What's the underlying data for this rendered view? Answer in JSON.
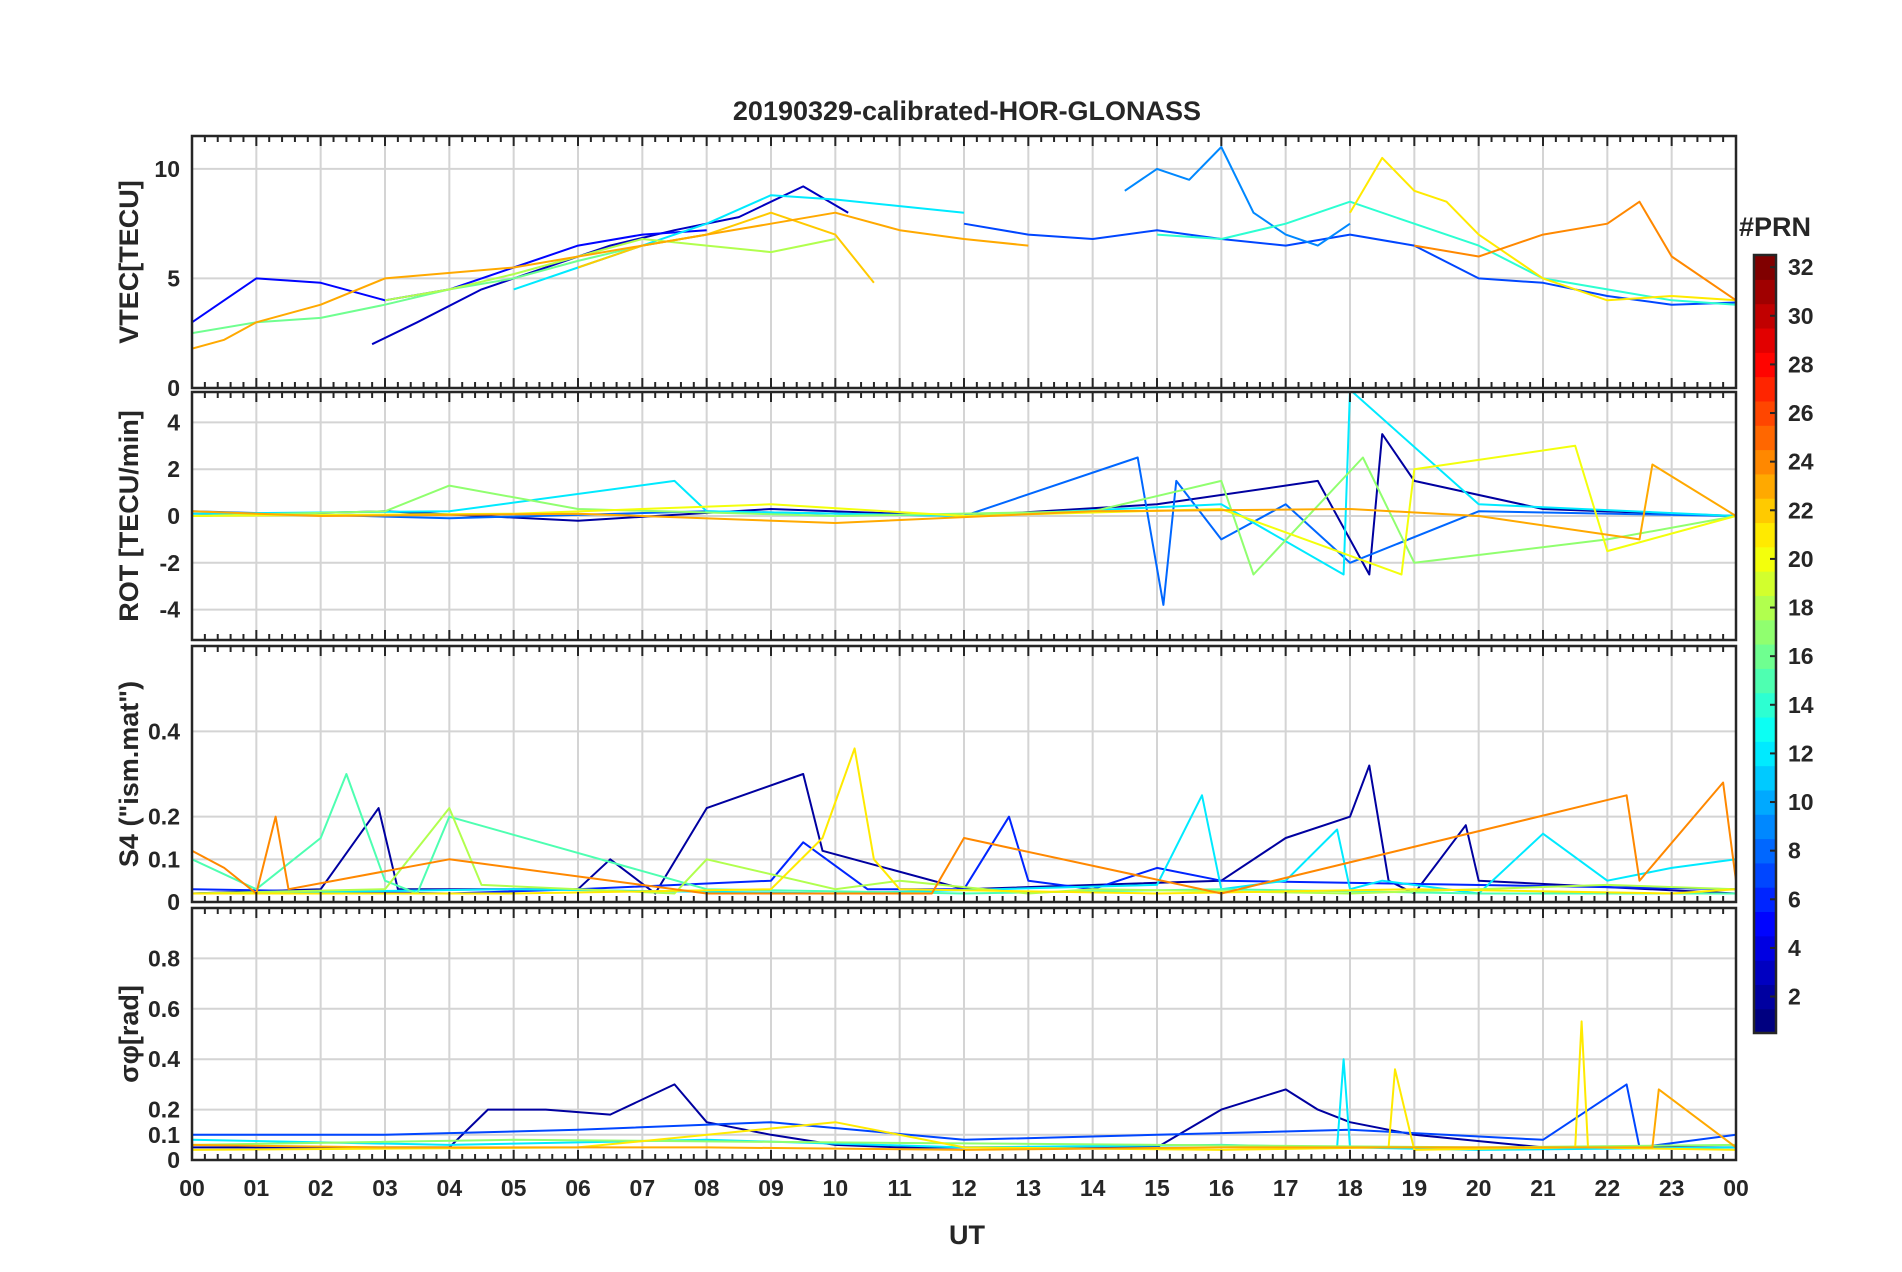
{
  "figure": {
    "title": "20190329-calibrated-HOR-GLONASS",
    "xlabel": "UT",
    "colorbar": {
      "label": "#PRN",
      "ticks": [
        "2",
        "4",
        "6",
        "8",
        "10",
        "12",
        "14",
        "16",
        "18",
        "20",
        "22",
        "24",
        "26",
        "28",
        "30",
        "32"
      ],
      "range": [
        1,
        32
      ],
      "colormap": "jet"
    }
  },
  "chart_data": [
    {
      "type": "line",
      "panel": "vtec",
      "ylabel": "VTEC[TECU]",
      "ylim": [
        0,
        11.5
      ],
      "yticks": [
        "0",
        "5",
        "10"
      ],
      "ytick_values": [
        0,
        5,
        10
      ],
      "xlim": [
        0,
        24
      ],
      "xtick_labels": [
        "00",
        "01",
        "02",
        "03",
        "04",
        "05",
        "06",
        "07",
        "08",
        "09",
        "10",
        "11",
        "12",
        "13",
        "14",
        "15",
        "16",
        "17",
        "18",
        "19",
        "20",
        "21",
        "22",
        "23",
        "00"
      ],
      "grid": true,
      "series": [
        {
          "prn": 3,
          "x": [
            2.8,
            3.5,
            4.5,
            5.5,
            6.5,
            7.5,
            8.5,
            9.5,
            10.2
          ],
          "y": [
            2.0,
            3.0,
            4.5,
            5.5,
            6.5,
            7.2,
            7.8,
            9.2,
            8.0
          ]
        },
        {
          "prn": 5,
          "x": [
            0,
            0.5,
            1,
            2,
            3,
            4,
            5,
            6,
            7,
            8
          ],
          "y": [
            3.0,
            4.0,
            5.0,
            4.8,
            4.0,
            4.5,
            5.5,
            6.5,
            7.0,
            7.2
          ]
        },
        {
          "prn": 7,
          "x": [
            12,
            13,
            14,
            15,
            16,
            17,
            18,
            19,
            20,
            21,
            22,
            23,
            24
          ],
          "y": [
            7.5,
            7.0,
            6.8,
            7.2,
            6.8,
            6.5,
            7.0,
            6.5,
            5.0,
            4.8,
            4.2,
            3.8,
            3.9
          ]
        },
        {
          "prn": 9,
          "x": [
            14.5,
            15,
            15.5,
            16,
            16.5,
            17,
            17.5,
            18
          ],
          "y": [
            9.0,
            10.0,
            9.5,
            11.0,
            8.0,
            7.0,
            6.5,
            7.5
          ]
        },
        {
          "prn": 12,
          "x": [
            5,
            6,
            7,
            8,
            9,
            10,
            11,
            12
          ],
          "y": [
            4.5,
            5.5,
            6.5,
            7.5,
            8.8,
            8.6,
            8.3,
            8.0
          ]
        },
        {
          "prn": 14,
          "x": [
            15,
            16,
            17,
            18,
            19,
            20,
            21,
            22,
            23,
            24
          ],
          "y": [
            7.0,
            6.8,
            7.5,
            8.5,
            7.5,
            6.5,
            5.0,
            4.5,
            4.0,
            3.8
          ]
        },
        {
          "prn": 16,
          "x": [
            0,
            1,
            2,
            3,
            4,
            5,
            6,
            7,
            8
          ],
          "y": [
            2.5,
            3.0,
            3.2,
            3.8,
            4.5,
            5.0,
            5.8,
            6.5,
            7.0
          ]
        },
        {
          "prn": 18,
          "x": [
            3,
            4,
            5,
            6,
            7,
            8,
            9,
            10
          ],
          "y": [
            4.0,
            4.5,
            5.2,
            6.0,
            6.8,
            6.5,
            6.2,
            6.8
          ]
        },
        {
          "prn": 21,
          "x": [
            18,
            18.5,
            19,
            19.5,
            20,
            21,
            22,
            23,
            24
          ],
          "y": [
            8.0,
            10.5,
            9.0,
            8.5,
            7.0,
            5.0,
            4.0,
            4.2,
            4.0
          ]
        },
        {
          "prn": 22,
          "x": [
            6,
            7,
            8,
            9,
            10,
            10.6
          ],
          "y": [
            5.5,
            6.5,
            7.0,
            8.0,
            7.0,
            4.8
          ]
        },
        {
          "prn": 23,
          "x": [
            0,
            0.5,
            1,
            2,
            3,
            5,
            7,
            8,
            9,
            10,
            11,
            12,
            13
          ],
          "y": [
            1.8,
            2.2,
            3.0,
            3.8,
            5.0,
            5.5,
            6.5,
            7.0,
            7.5,
            8.0,
            7.2,
            6.8,
            6.5
          ]
        },
        {
          "prn": 24,
          "x": [
            19,
            20,
            21,
            22,
            22.5,
            23,
            24
          ],
          "y": [
            6.5,
            6.0,
            7.0,
            7.5,
            8.5,
            6.0,
            4.0
          ]
        }
      ]
    },
    {
      "type": "line",
      "panel": "rot",
      "ylabel": "ROT [TECU/min]",
      "ylim": [
        -5.3,
        5.3
      ],
      "yticks": [
        "-4",
        "-2",
        "0",
        "2",
        "4"
      ],
      "ytick_values": [
        -4,
        -2,
        0,
        2,
        4
      ],
      "xlim": [
        0,
        24
      ],
      "grid": true,
      "series": [
        {
          "prn": 2,
          "x": [
            0,
            3,
            6,
            9,
            12,
            15,
            17.5,
            18.3,
            18.5,
            19,
            21,
            24
          ],
          "y": [
            0,
            0.2,
            -0.2,
            0.3,
            0,
            0.5,
            1.5,
            -2.5,
            3.5,
            1.5,
            0.3,
            0
          ]
        },
        {
          "prn": 8,
          "x": [
            0,
            4,
            8,
            12,
            14.7,
            15.1,
            15.3,
            16,
            17,
            18,
            20,
            24
          ],
          "y": [
            0.2,
            -0.1,
            0.2,
            0,
            2.5,
            -3.8,
            1.5,
            -1.0,
            0.5,
            -2.0,
            0.2,
            0
          ]
        },
        {
          "prn": 12,
          "x": [
            0,
            4,
            7.5,
            8,
            12,
            16,
            17.9,
            18,
            20,
            24
          ],
          "y": [
            0.1,
            0.2,
            1.5,
            0.2,
            0,
            0.5,
            -2.5,
            5.4,
            0.5,
            0
          ]
        },
        {
          "prn": 17,
          "x": [
            0,
            3,
            4,
            6,
            10,
            14,
            16,
            16.5,
            18.2,
            19,
            22,
            24
          ],
          "y": [
            0,
            0.2,
            1.3,
            0.3,
            0,
            0.2,
            1.5,
            -2.5,
            2.5,
            -2.0,
            -1.0,
            0
          ]
        },
        {
          "prn": 20,
          "x": [
            0,
            5,
            9,
            12,
            16,
            18.8,
            19,
            21.5,
            22,
            24
          ],
          "y": [
            0,
            0.1,
            0.5,
            0,
            0.3,
            -2.5,
            2.0,
            3.0,
            -1.5,
            0
          ]
        },
        {
          "prn": 23,
          "x": [
            0,
            2,
            6,
            10,
            14,
            18,
            20,
            22.5,
            22.7,
            24
          ],
          "y": [
            0.2,
            0,
            0.1,
            -0.3,
            0.2,
            0.3,
            0,
            -1.0,
            2.2,
            0
          ]
        }
      ]
    },
    {
      "type": "line",
      "panel": "s4",
      "ylabel": "S4 (\"ism.mat\")",
      "ylim": [
        0,
        0.6
      ],
      "yticks": [
        "0",
        "0.1",
        "0.2",
        "0.4"
      ],
      "ytick_values": [
        0,
        0.1,
        0.2,
        0.4
      ],
      "xlim": [
        0,
        24
      ],
      "grid": true,
      "series": [
        {
          "prn": 2,
          "x": [
            0,
            2,
            2.9,
            3.2,
            6,
            6.5,
            7.2,
            8,
            9.5,
            9.8,
            12,
            16,
            17,
            18,
            18.3,
            18.6,
            19,
            19.8,
            20,
            24
          ],
          "y": [
            0.02,
            0.03,
            0.22,
            0.03,
            0.03,
            0.1,
            0.02,
            0.22,
            0.3,
            0.12,
            0.03,
            0.05,
            0.15,
            0.2,
            0.32,
            0.05,
            0.02,
            0.18,
            0.05,
            0.02
          ]
        },
        {
          "prn": 6,
          "x": [
            0,
            4,
            6,
            9,
            9.5,
            10.5,
            12,
            12.7,
            13,
            14,
            15,
            16,
            24
          ],
          "y": [
            0.03,
            0.02,
            0.03,
            0.05,
            0.14,
            0.03,
            0.03,
            0.2,
            0.05,
            0.03,
            0.08,
            0.05,
            0.03
          ]
        },
        {
          "prn": 12,
          "x": [
            0,
            5,
            10,
            15,
            15.7,
            16,
            17,
            17.8,
            18,
            18.5,
            20,
            21,
            22,
            23,
            24
          ],
          "y": [
            0.02,
            0.03,
            0.02,
            0.04,
            0.25,
            0.03,
            0.05,
            0.17,
            0.03,
            0.05,
            0.02,
            0.16,
            0.05,
            0.08,
            0.1
          ]
        },
        {
          "prn": 15,
          "x": [
            0,
            1,
            2,
            2.4,
            3,
            3.5,
            4,
            8,
            12,
            16,
            20,
            24
          ],
          "y": [
            0.1,
            0.03,
            0.15,
            0.3,
            0.05,
            0.02,
            0.2,
            0.03,
            0.02,
            0.03,
            0.02,
            0.02
          ]
        },
        {
          "prn": 18,
          "x": [
            0,
            3,
            4,
            4.5,
            6,
            7.5,
            8,
            10,
            11,
            13,
            14,
            18,
            22,
            24
          ],
          "y": [
            0.02,
            0.03,
            0.22,
            0.04,
            0.03,
            0.02,
            0.1,
            0.03,
            0.05,
            0.02,
            0.03,
            0.02,
            0.04,
            0.03
          ]
        },
        {
          "prn": 21,
          "x": [
            0,
            5,
            9,
            9.8,
            10.3,
            10.6,
            11,
            15,
            19,
            23,
            24
          ],
          "y": [
            0.02,
            0.02,
            0.03,
            0.15,
            0.36,
            0.1,
            0.03,
            0.02,
            0.03,
            0.02,
            0.03
          ]
        },
        {
          "prn": 24,
          "x": [
            0,
            0.5,
            1,
            1.3,
            1.5,
            4,
            8,
            11.5,
            12,
            16,
            22.3,
            22.5,
            23.8,
            24
          ],
          "y": [
            0.12,
            0.08,
            0.02,
            0.2,
            0.03,
            0.1,
            0.02,
            0.02,
            0.15,
            0.02,
            0.25,
            0.05,
            0.28,
            0.05
          ]
        }
      ]
    },
    {
      "type": "line",
      "panel": "sigma_phi",
      "ylabel": "σφ[rad]",
      "ylim": [
        0,
        1.0
      ],
      "yticks": [
        "0",
        "0.1",
        "0.2",
        "0.4",
        "0.6",
        "0.8"
      ],
      "ytick_values": [
        0,
        0.1,
        0.2,
        0.4,
        0.6,
        0.8
      ],
      "xlim": [
        0,
        24
      ],
      "grid": true,
      "series": [
        {
          "prn": 2,
          "x": [
            0,
            4,
            4.6,
            5.5,
            6.5,
            7.5,
            8,
            9,
            10,
            11,
            15,
            16,
            17,
            17.5,
            18,
            19,
            21,
            24
          ],
          "y": [
            0.05,
            0.05,
            0.2,
            0.2,
            0.18,
            0.3,
            0.15,
            0.1,
            0.06,
            0.05,
            0.05,
            0.2,
            0.28,
            0.2,
            0.15,
            0.1,
            0.05,
            0.05
          ]
        },
        {
          "prn": 7,
          "x": [
            0,
            3,
            6,
            9,
            12,
            15,
            18,
            21,
            22.3,
            22.5,
            24
          ],
          "y": [
            0.1,
            0.1,
            0.12,
            0.15,
            0.08,
            0.1,
            0.12,
            0.08,
            0.3,
            0.05,
            0.1
          ]
        },
        {
          "prn": 12,
          "x": [
            0,
            4,
            8,
            12,
            16,
            17.8,
            17.9,
            18,
            20,
            24
          ],
          "y": [
            0.08,
            0.06,
            0.08,
            0.05,
            0.06,
            0.05,
            0.4,
            0.05,
            0.04,
            0.05
          ]
        },
        {
          "prn": 17,
          "x": [
            0,
            5,
            10,
            15,
            20,
            24
          ],
          "y": [
            0.06,
            0.08,
            0.07,
            0.06,
            0.05,
            0.06
          ]
        },
        {
          "prn": 21,
          "x": [
            0,
            6,
            10,
            12,
            16,
            18.6,
            18.7,
            19,
            21.5,
            21.6,
            21.7,
            24
          ],
          "y": [
            0.04,
            0.05,
            0.15,
            0.05,
            0.04,
            0.05,
            0.36,
            0.04,
            0.05,
            0.55,
            0.05,
            0.04
          ]
        },
        {
          "prn": 23,
          "x": [
            0,
            3,
            8,
            12,
            16,
            20,
            22.7,
            22.8,
            24
          ],
          "y": [
            0.06,
            0.05,
            0.05,
            0.04,
            0.05,
            0.05,
            0.05,
            0.28,
            0.05
          ]
        }
      ]
    }
  ]
}
